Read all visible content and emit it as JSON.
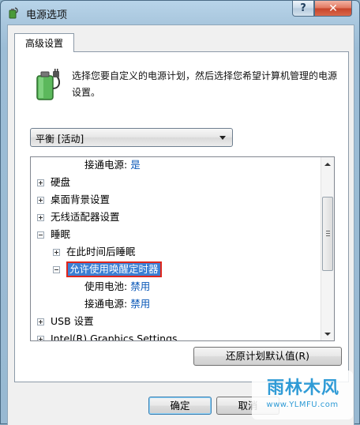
{
  "window": {
    "title": "电源选项",
    "help_label": "?",
    "close_label": "✕"
  },
  "tab": {
    "label": "高级设置"
  },
  "description": "选择您要自定义的电源计划，然后选择您希望计算机管理的电源设置。",
  "plan_select": {
    "value": "平衡 [活动]"
  },
  "tree": {
    "rows": [
      {
        "label": "接通电源:",
        "value": "是"
      },
      {
        "label": "硬盘",
        "expander": "plus"
      },
      {
        "label": "桌面背景设置",
        "expander": "plus"
      },
      {
        "label": "无线适配器设置",
        "expander": "plus"
      },
      {
        "label": "睡眠",
        "expander": "minus"
      },
      {
        "label": "在此时间后睡眠",
        "expander": "plus"
      },
      {
        "label": "允许使用唤醒定时器",
        "expander": "minus",
        "selected": true
      },
      {
        "label": "使用电池:",
        "value": "禁用"
      },
      {
        "label": "接通电源:",
        "value": "禁用"
      },
      {
        "label": "USB 设置",
        "expander": "plus"
      },
      {
        "label": "Intel(R) Graphics Settings",
        "expander": "plus"
      }
    ]
  },
  "buttons": {
    "restore": "还原计划默认值(R)",
    "ok": "确定",
    "cancel": "取消"
  },
  "watermark": {
    "text": "雨林木风",
    "url": "www.YLMFU.com"
  },
  "colors": {
    "selection": "#3b7fd4",
    "highlight_border": "#e0261c",
    "value_text": "#0a58b8"
  }
}
